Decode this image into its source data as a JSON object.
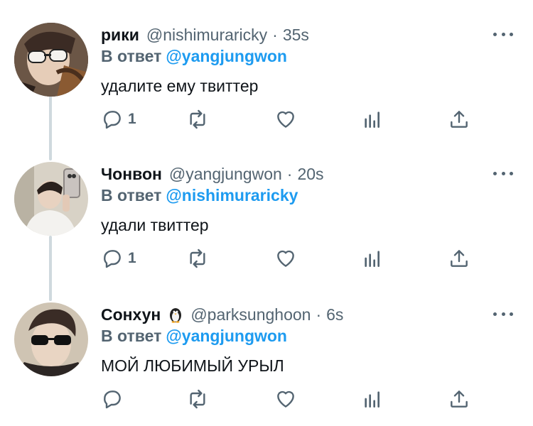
{
  "tweets": [
    {
      "display_name": "рики",
      "handle": "@nishimuraricky",
      "separator": "·",
      "time": "35s",
      "reply_prefix": "В ответ",
      "reply_to": "@yangjungwon",
      "text": "удалите ему твиттер",
      "reply_count": "1",
      "has_emoji": false
    },
    {
      "display_name": "Чонвон",
      "handle": "@yangjungwon",
      "separator": "·",
      "time": "20s",
      "reply_prefix": "В ответ",
      "reply_to": "@nishimuraricky",
      "text": "удали твиттер",
      "reply_count": "1",
      "has_emoji": false
    },
    {
      "display_name": "Сонхун",
      "handle": "@parksunghoon",
      "separator": "·",
      "time": "6s",
      "reply_prefix": "В ответ",
      "reply_to": "@yangjungwon",
      "text": "МОЙ ЛЮБИМЫЙ УРЫЛ",
      "reply_count": "",
      "has_emoji": true,
      "emoji_icon": "penguin-icon"
    }
  ],
  "colors": {
    "mention": "#1d9bf0",
    "muted": "#536471",
    "text": "#0f1419",
    "thread_line": "#cfd9de"
  }
}
